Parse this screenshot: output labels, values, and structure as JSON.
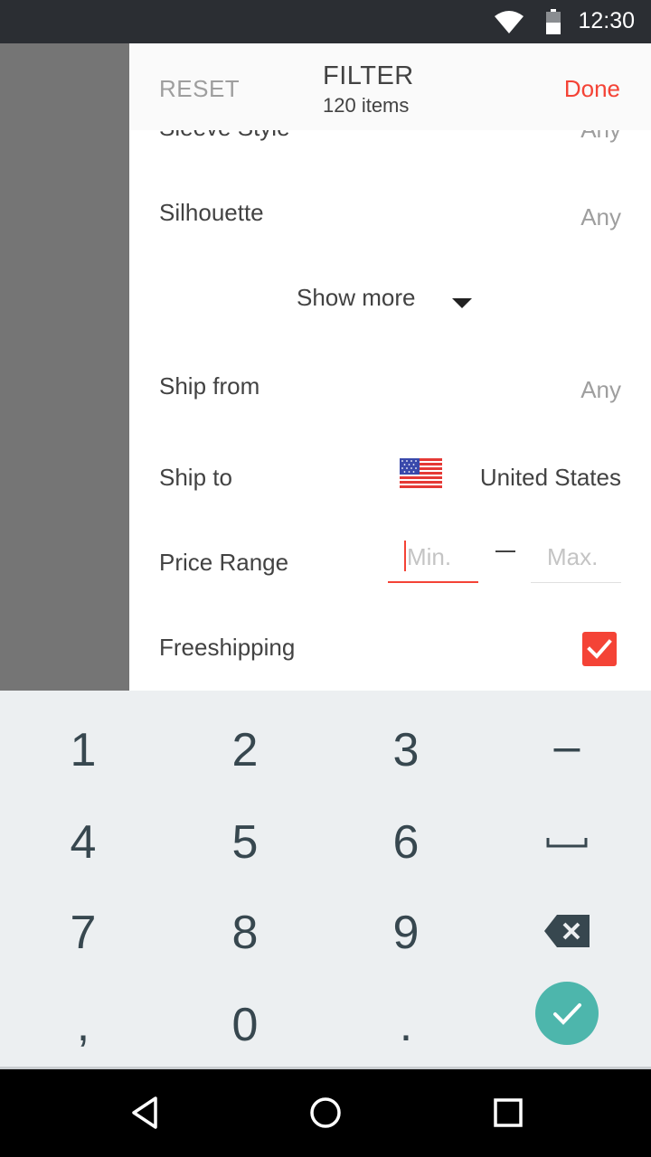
{
  "status_bar": {
    "time": "12:30",
    "icons": [
      "wifi-icon",
      "battery-icon"
    ]
  },
  "header": {
    "reset_label": "RESET",
    "title": "FILTER",
    "subtitle": "120 items",
    "done_label": "Done"
  },
  "filters": {
    "sleeve_style": {
      "label": "Sleeve Style",
      "value": "Any"
    },
    "silhouette": {
      "label": "Silhouette",
      "value": "Any"
    },
    "show_more_label": "Show more",
    "ship_from": {
      "label": "Ship from",
      "value": "Any"
    },
    "ship_to": {
      "label": "Ship to",
      "value": "United States",
      "flag_icon": "us-flag-icon"
    },
    "price_range": {
      "label": "Price Range",
      "min_placeholder": "Min.",
      "max_placeholder": "Max.",
      "separator": "—"
    },
    "freeshipping": {
      "label": "Freeshipping",
      "checked": true
    }
  },
  "keypad": {
    "rows": [
      [
        "1",
        "2",
        "3",
        "–"
      ],
      [
        "4",
        "5",
        "6",
        "space-icon"
      ],
      [
        "7",
        "8",
        "9",
        "backspace-icon"
      ],
      [
        ",",
        "0",
        ".",
        "enter-icon"
      ]
    ]
  },
  "nav_bar": {
    "buttons": [
      "back-icon",
      "home-icon",
      "recents-icon"
    ]
  },
  "colors": {
    "accent": "#f44336",
    "keypad_bg": "#eceff1",
    "enter_key": "#4db6ac",
    "status_bar": "#2b2e33"
  }
}
